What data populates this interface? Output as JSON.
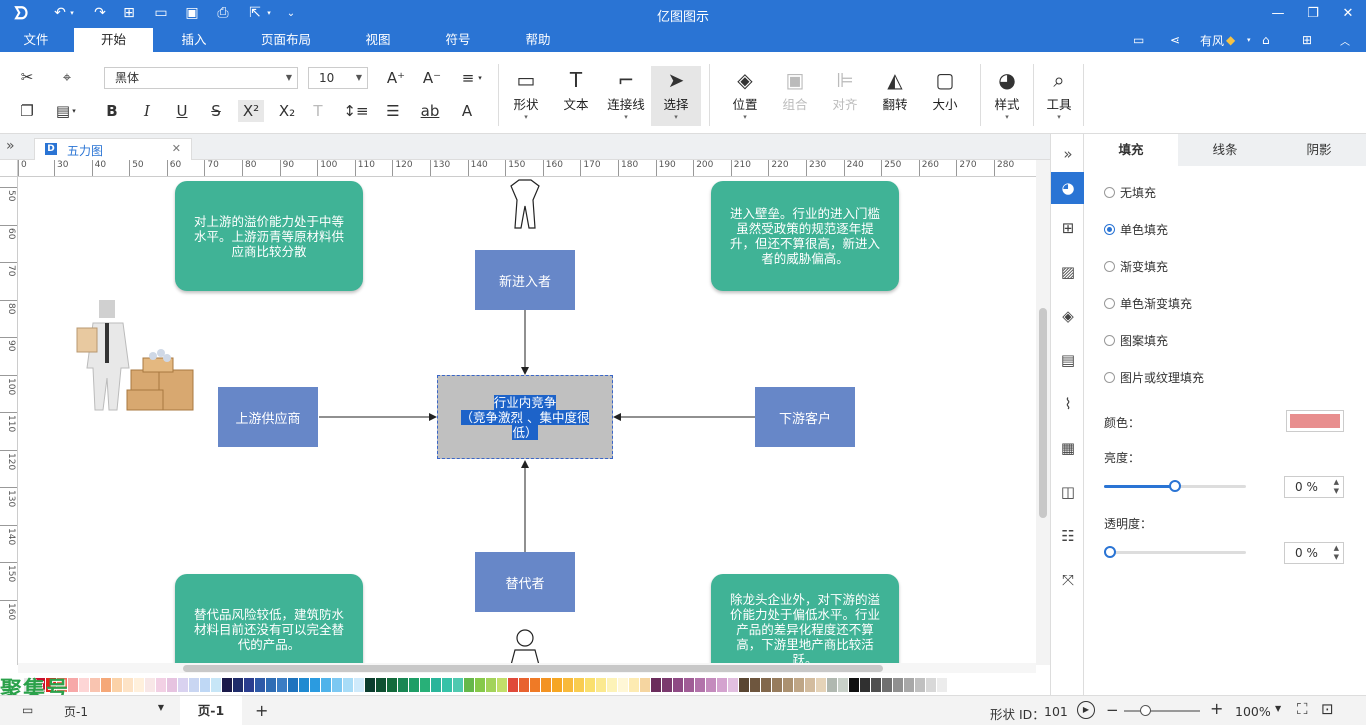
{
  "app": {
    "title": "亿图图示"
  },
  "menu": {
    "file": "文件",
    "tabs": [
      "开始",
      "插入",
      "页面布局",
      "视图",
      "符号",
      "帮助"
    ],
    "user": "有风"
  },
  "ribbon": {
    "font_name": "黑体",
    "font_size": "10",
    "buttons": {
      "shape": "形状",
      "text": "文本",
      "connector": "连接线",
      "select": "选择",
      "position": "位置",
      "group": "组合",
      "align": "对齐",
      "flip": "翻转",
      "size": "大小",
      "style": "样式",
      "tools": "工具"
    }
  },
  "doc_tab": {
    "name": "五力图"
  },
  "ruler": {
    "h": [
      "0",
      "30",
      "40",
      "50",
      "60",
      "70",
      "80",
      "90",
      "100",
      "110",
      "120",
      "130",
      "140",
      "150",
      "160",
      "170",
      "180",
      "190",
      "200",
      "210",
      "220",
      "230",
      "240",
      "250",
      "260",
      "270",
      "280"
    ],
    "v": [
      "50",
      "60",
      "70",
      "80",
      "90",
      "100",
      "110",
      "120",
      "130",
      "140",
      "150",
      "160"
    ]
  },
  "diagram": {
    "top_left": "对上游的溢价能力处于中等水平。上游沥青等原材料供应商比较分散",
    "top_right": "进入壁垒。行业的进入门槛虽然受政策的规范逐年提升，但还不算很高，新进入者的威胁偏高。",
    "bottom_left": "替代品风险较低，建筑防水材料目前还没有可以完全替代的产品。",
    "bottom_right": "除龙头企业外，对下游的溢价能力处于偏低水平。行业产品的差异化程度还不算高，下游里地产商比较活跃。",
    "new_entrant": "新进入者",
    "supplier": "上游供应商",
    "customer": "下游客户",
    "substitute": "替代者",
    "center_line1": "行业内竞争",
    "center_line2": "（竞争激烈 、集中度很",
    "center_line3": "低）"
  },
  "palette": [
    "#e8e8e8",
    "#c8102e",
    "#e2231a",
    "#f26b5b",
    "#f7a8a8",
    "#fdd5d5",
    "#f9c4b0",
    "#f5a878",
    "#fbd2a8",
    "#fde3c6",
    "#fff0dc",
    "#f8e7e7",
    "#f2d0e4",
    "#e6c3e0",
    "#d9d2f0",
    "#c9d6f2",
    "#bfd8f5",
    "#c7e6f7",
    "#1a1a4a",
    "#1f2c6b",
    "#2a3d8f",
    "#2e5aa8",
    "#2f6db5",
    "#3b7dc4",
    "#1e73be",
    "#1f8ad1",
    "#2b9be0",
    "#4fb3ea",
    "#7cc8f2",
    "#a8dcf7",
    "#cfeafb",
    "#0b3d2e",
    "#0f5132",
    "#136b3c",
    "#198754",
    "#1e9e66",
    "#28b078",
    "#2ab59a",
    "#36c2a8",
    "#4fc9b0",
    "#66b84a",
    "#86c94a",
    "#a3d35a",
    "#c2df6a",
    "#e04a3a",
    "#e8622f",
    "#ef7a26",
    "#f39322",
    "#f6a623",
    "#f8b93a",
    "#f9cc4f",
    "#fadf6d",
    "#fbe98f",
    "#fdf3b8",
    "#fff7d6",
    "#fdebb2",
    "#f5d5a0",
    "#6b2d5c",
    "#7b3a6e",
    "#8e4a84",
    "#a05d96",
    "#b273aa",
    "#c48bbd",
    "#d4a3cf",
    "#e2bfe0",
    "#5a4632",
    "#6e563e",
    "#82684c",
    "#977c5d",
    "#ab9170",
    "#bfa686",
    "#d3bc9e",
    "#e5d3b8",
    "#b0b8b0",
    "#c8d0c8",
    "#101010",
    "#303030",
    "#505050",
    "#707070",
    "#909090",
    "#a8a8a8",
    "#c0c0c0",
    "#d8d8d8",
    "#ececec",
    "#ffffff"
  ],
  "status": {
    "page_menu": "页-1",
    "page_tab": "页-1",
    "shape_id_label": "形状 ID：",
    "shape_id": "101",
    "zoom": "100%"
  },
  "panel": {
    "tabs": [
      "填充",
      "线条",
      "阴影"
    ],
    "fill_options": [
      "无填充",
      "单色填充",
      "渐变填充",
      "单色渐变填充",
      "图案填充",
      "图片或纹理填充"
    ],
    "selected_option": 1,
    "color_label": "颜色：",
    "fill_color": "#e88e8e",
    "brightness_label": "亮度：",
    "brightness_value": "0 %",
    "brightness_slider_fraction": 0.5,
    "opacity_label": "透明度：",
    "opacity_value": "0 %",
    "opacity_slider_fraction": 0.0
  },
  "watermark": "聚集号"
}
